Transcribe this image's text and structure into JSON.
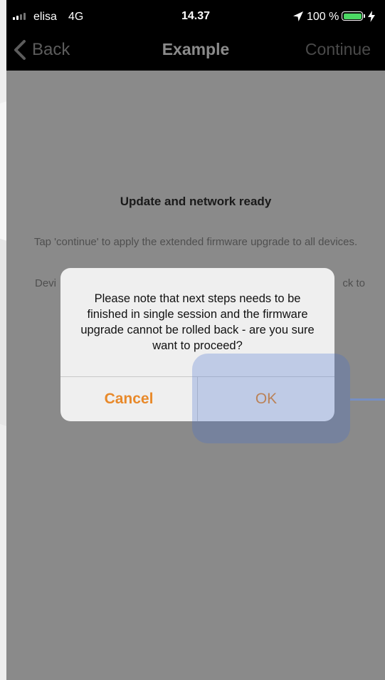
{
  "status_bar": {
    "carrier": "elisa",
    "network": "4G",
    "time": "14.37",
    "battery_percent": "100 %",
    "battery_level": 1.0,
    "battery_color": "#4cd964",
    "icons": [
      "signal-icon",
      "location-arrow-icon",
      "battery-icon",
      "charging-bolt-icon"
    ]
  },
  "nav": {
    "back_label": "Back",
    "title": "Example",
    "continue_label": "Continue"
  },
  "content": {
    "heading": "Update and network ready",
    "paragraph_1": "Tap 'continue' to apply the extended firmware upgrade to all devices.",
    "paragraph_2_start": "Devi",
    "paragraph_2_end": "ck to"
  },
  "dialog": {
    "message": "Please note that next steps needs to be finished in single session and the firmware upgrade cannot be rolled back - are you sure want to proceed?",
    "cancel_label": "Cancel",
    "ok_label": "OK",
    "button_color": "#e8892a"
  }
}
